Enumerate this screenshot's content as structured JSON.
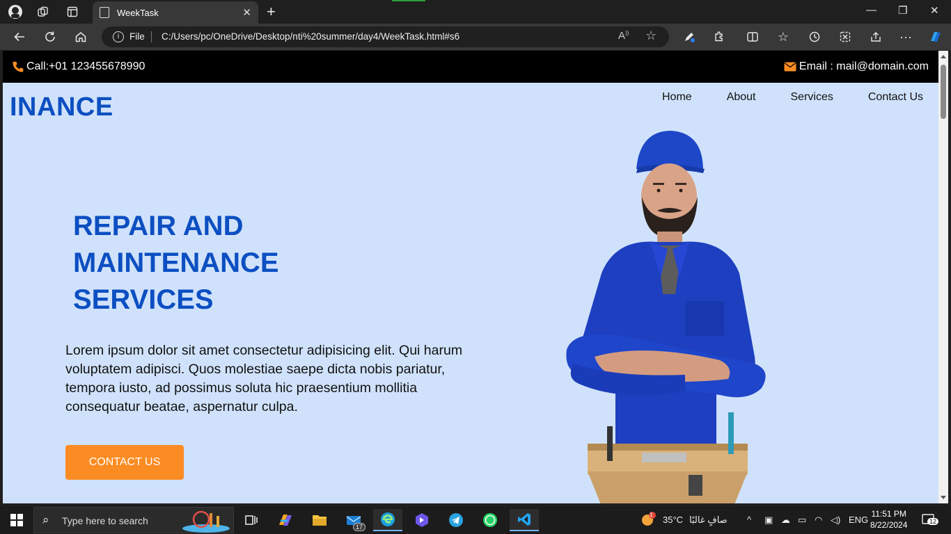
{
  "browser": {
    "tab_title": "WeekTask",
    "file_label": "File",
    "url": "C:/Users/pc/OneDrive/Desktop/nti%20summer/day4/WeekTask.html#s6"
  },
  "page": {
    "call_text": "Call:+01 123455678990",
    "email_text": "Email : mail@domain.com",
    "logo": "INANCE",
    "nav": [
      "Home",
      "About",
      "Services",
      "Contact Us"
    ],
    "hero_title": "REPAIR AND MAINTENANCE SERVICES",
    "hero_text": "Lorem ipsum dolor sit amet consectetur adipisicing elit. Qui harum voluptatem adipisci. Quos molestiae saepe dicta nobis pariatur, tempora iusto, ad possimus soluta hic praesentium mollitia consequatur beatae, aspernatur culpa.",
    "cta_label": "CONTACT US"
  },
  "taskbar": {
    "search_placeholder": "Type here to search",
    "mail_badge": "17",
    "temperature": "35°C",
    "weather_text": "صافٍ غالبًا",
    "language": "ENG",
    "time": "11:51 PM",
    "date": "8/22/2024",
    "notifications": "12",
    "weather_badge": "1"
  },
  "colors": {
    "accent": "#0c4fc2",
    "hero_bg": "#d0e2fb",
    "cta": "#fb8c23",
    "contact_icons": "#fb8c23"
  },
  "icons": [
    "profile-avatar-icon",
    "workspaces-icon",
    "tab-actions-icon",
    "page-icon",
    "close-icon",
    "new-tab-icon",
    "minimize-icon",
    "maximize-icon",
    "window-close-icon",
    "back-icon",
    "refresh-icon",
    "home-icon",
    "info-icon",
    "read-aloud-icon",
    "favorite-star-icon",
    "pen-icon",
    "extensions-icon",
    "split-screen-icon",
    "favorites-icon",
    "history-icon",
    "screenshot-icon",
    "share-icon",
    "more-icon",
    "copilot-icon",
    "phone-icon",
    "mail-icon",
    "windows-start-icon",
    "search-icon"
  ]
}
